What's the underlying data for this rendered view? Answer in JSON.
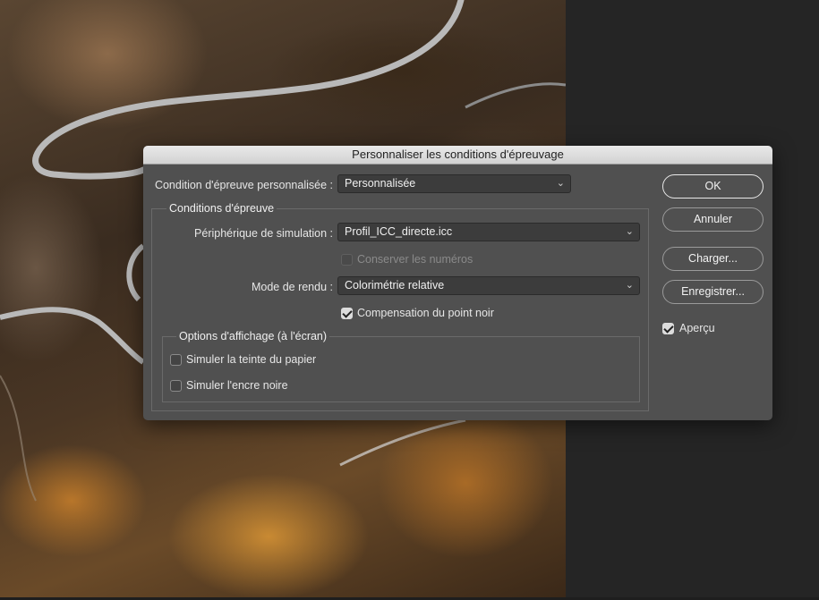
{
  "dialog": {
    "title": "Personnaliser les conditions d'épreuvage",
    "custom_condition_label": "Condition d'épreuve personnalisée :",
    "custom_condition_value": "Personnalisée",
    "proof_conditions_legend": "Conditions d'épreuve",
    "simulation_device_label": "Périphérique de simulation :",
    "simulation_device_value": "Profil_ICC_directe.icc",
    "preserve_numbers_label": "Conserver les numéros",
    "preserve_numbers_checked": false,
    "rendering_intent_label": "Mode de rendu :",
    "rendering_intent_value": "Colorimétrie relative",
    "black_point_label": "Compensation du point noir",
    "black_point_checked": true,
    "display_options_legend": "Options d'affichage (à l'écran)",
    "simulate_paper_label": "Simuler la teinte du papier",
    "simulate_paper_checked": false,
    "simulate_ink_label": "Simuler l'encre noire",
    "simulate_ink_checked": false
  },
  "buttons": {
    "ok": "OK",
    "cancel": "Annuler",
    "load": "Charger...",
    "save": "Enregistrer..."
  },
  "preview": {
    "label": "Aperçu",
    "checked": true
  },
  "icons": {
    "dropdown": "chevron-updown-icon",
    "checkmark": "checkmark-icon"
  },
  "colors": {
    "dialog_bg": "#505050",
    "titlebar_bg": "#dcdcdc",
    "field_bg": "#3c3c3c"
  }
}
